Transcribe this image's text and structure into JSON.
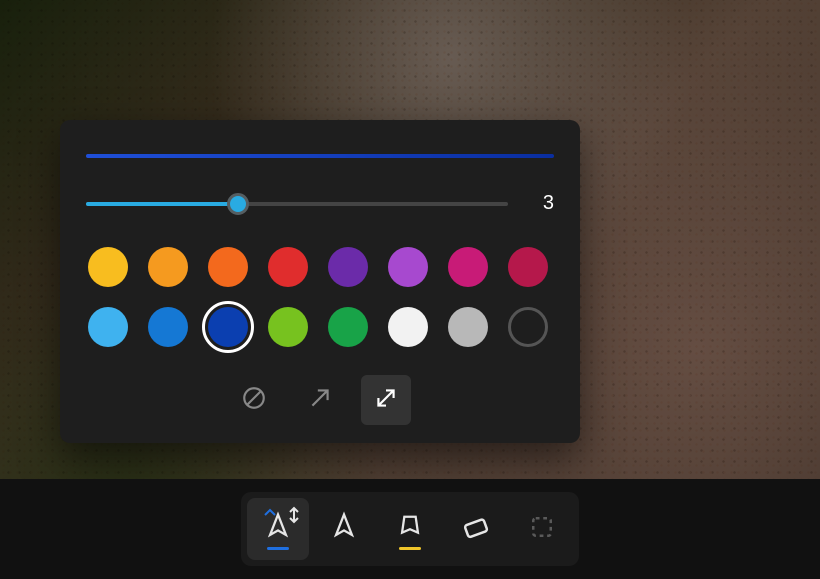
{
  "preview": {
    "color": "#1f4fd8"
  },
  "slider": {
    "value": "3",
    "percent": 36
  },
  "swatches": [
    {
      "name": "yellow",
      "hex": "#f8bd1f",
      "selected": false,
      "hollow": false
    },
    {
      "name": "amber",
      "hex": "#f59a1f",
      "selected": false,
      "hollow": false
    },
    {
      "name": "orange",
      "hex": "#f3691d",
      "selected": false,
      "hollow": false
    },
    {
      "name": "red",
      "hex": "#e02d2d",
      "selected": false,
      "hollow": false
    },
    {
      "name": "purple",
      "hex": "#6b2ba9",
      "selected": false,
      "hollow": false
    },
    {
      "name": "violet",
      "hex": "#a749cf",
      "selected": false,
      "hollow": false
    },
    {
      "name": "magenta",
      "hex": "#c81b77",
      "selected": false,
      "hollow": false
    },
    {
      "name": "crimson",
      "hex": "#b5184b",
      "selected": false,
      "hollow": false
    },
    {
      "name": "sky",
      "hex": "#3fb2ef",
      "selected": false,
      "hollow": false
    },
    {
      "name": "azure",
      "hex": "#1578d4",
      "selected": false,
      "hollow": false
    },
    {
      "name": "blue",
      "hex": "#0b3fb0",
      "selected": true,
      "hollow": false
    },
    {
      "name": "lime",
      "hex": "#77c21f",
      "selected": false,
      "hollow": false
    },
    {
      "name": "green",
      "hex": "#18a348",
      "selected": false,
      "hollow": false
    },
    {
      "name": "white",
      "hex": "#f2f2f2",
      "selected": false,
      "hollow": false
    },
    {
      "name": "gray",
      "hex": "#b8b8b8",
      "selected": false,
      "hollow": false
    },
    {
      "name": "custom",
      "hex": "#000000",
      "selected": false,
      "hollow": true
    }
  ],
  "tips": [
    {
      "id": "none",
      "active": false
    },
    {
      "id": "single",
      "active": false
    },
    {
      "id": "double",
      "active": true
    }
  ],
  "tools": [
    {
      "id": "pen",
      "active": true,
      "underline": "#1f6fe0",
      "chevron": true,
      "upcaret": true
    },
    {
      "id": "pencil",
      "active": false,
      "underline": null
    },
    {
      "id": "highlighter",
      "active": false,
      "underline": "#f0c52a"
    },
    {
      "id": "eraser",
      "active": false,
      "underline": null
    },
    {
      "id": "crop",
      "active": false,
      "underline": null,
      "dim": true
    }
  ]
}
